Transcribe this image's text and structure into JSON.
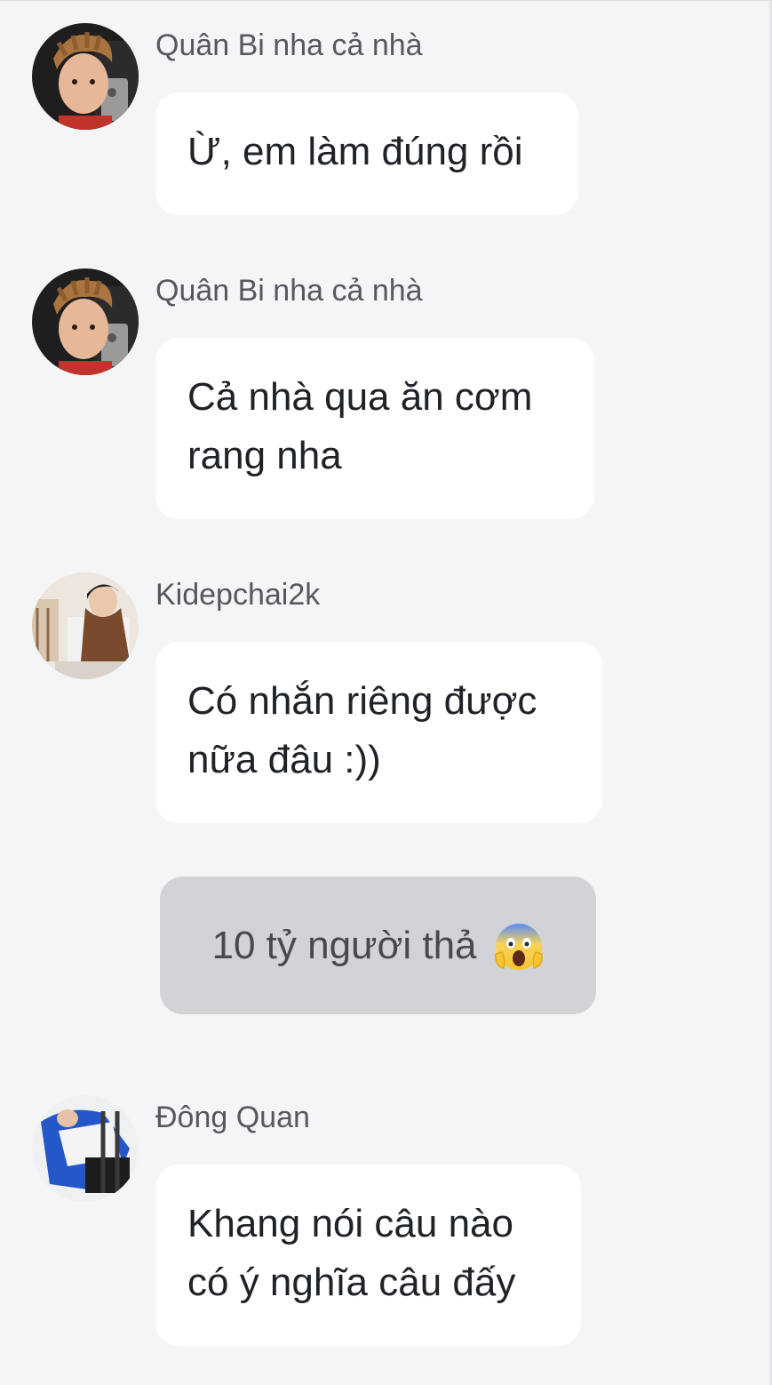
{
  "messages": [
    {
      "sender": "Quân Bi nha cả nhà",
      "avatar_icon": "user-avatar-photo",
      "lines": [
        "Ừ, em làm đúng rồi"
      ]
    },
    {
      "sender": "Quân Bi nha cả nhà",
      "avatar_icon": "user-avatar-photo",
      "lines": [
        "Cả nhà qua ăn cơm",
        "rang nha"
      ]
    },
    {
      "sender": "Kidepchai2k",
      "avatar_icon": "user-avatar-photo",
      "lines": [
        "Có nhắn riêng được",
        "nữa đâu :))"
      ]
    },
    {
      "sender": "Đông Quan",
      "avatar_icon": "user-avatar-photo",
      "lines": [
        "Khang nói câu nào",
        "có ý nghĩa câu đấy"
      ]
    }
  ],
  "system_notice": {
    "text": "10 tỷ người thả",
    "emoji_icon": "screaming-face-emoji"
  },
  "colors": {
    "background": "#f4f5f7",
    "bubble": "#ffffff",
    "system_bubble": "#d2d3d6",
    "sender_text": "#55595f",
    "message_text": "#1f2227"
  }
}
